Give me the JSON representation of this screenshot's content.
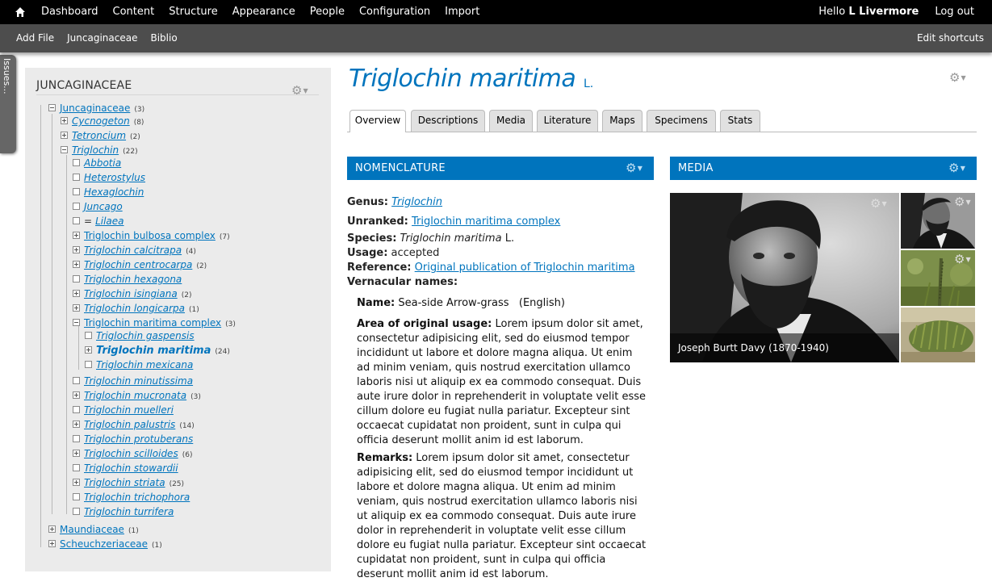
{
  "toolbar": {
    "menu": [
      "Dashboard",
      "Content",
      "Structure",
      "Appearance",
      "People",
      "Configuration",
      "Import"
    ],
    "hello_prefix": "Hello ",
    "user": "L Livermore",
    "logout": "Log out"
  },
  "shortcuts": {
    "items": [
      "Add File",
      "Juncaginaceae",
      "Biblio"
    ],
    "edit": "Edit shortcuts"
  },
  "issues_tab": "Issues...",
  "tree": {
    "title": "JUNCAGINACEAE",
    "nodes": [
      {
        "label": "Juncaginaceae",
        "count": "(3)"
      },
      {
        "label": "Cycnogeton",
        "count": "(8)"
      },
      {
        "label": "Tetroncium",
        "count": "(2)"
      },
      {
        "label": "Triglochin",
        "count": "(22)"
      },
      {
        "label": "Abbotia",
        "count": ""
      },
      {
        "label": "Heterostylus",
        "count": ""
      },
      {
        "label": "Hexaglochin",
        "count": ""
      },
      {
        "label": "Juncago",
        "count": ""
      },
      {
        "label": "Lilaea",
        "count": "",
        "prefix": "="
      },
      {
        "label": "Triglochin bulbosa complex",
        "count": "(7)"
      },
      {
        "label": "Triglochin calcitrapa",
        "count": "(4)"
      },
      {
        "label": "Triglochin centrocarpa",
        "count": "(2)"
      },
      {
        "label": "Triglochin hexagona",
        "count": ""
      },
      {
        "label": "Triglochin isingiana",
        "count": "(2)"
      },
      {
        "label": "Triglochin longicarpa",
        "count": "(1)"
      },
      {
        "label": "Triglochin maritima complex",
        "count": "(3)"
      },
      {
        "label": "Triglochin gaspensis",
        "count": ""
      },
      {
        "label": "Triglochin maritima",
        "count": "(24)"
      },
      {
        "label": "Triglochin mexicana",
        "count": ""
      },
      {
        "label": "Triglochin minutissima",
        "count": ""
      },
      {
        "label": "Triglochin mucronata",
        "count": "(3)"
      },
      {
        "label": "Triglochin muelleri",
        "count": ""
      },
      {
        "label": "Triglochin palustris",
        "count": "(14)"
      },
      {
        "label": "Triglochin protuberans",
        "count": ""
      },
      {
        "label": "Triglochin scilloides",
        "count": "(6)"
      },
      {
        "label": "Triglochin stowardii",
        "count": ""
      },
      {
        "label": "Triglochin striata",
        "count": "(25)"
      },
      {
        "label": "Triglochin trichophora",
        "count": ""
      },
      {
        "label": "Triglochin turrifera",
        "count": ""
      },
      {
        "label": "Maundiaceae",
        "count": "(1)"
      },
      {
        "label": "Scheuchzeriaceae",
        "count": "(1)"
      }
    ]
  },
  "taxon": {
    "name": "Triglochin maritima",
    "author": "L."
  },
  "tabs": [
    "Overview",
    "Descriptions",
    "Media",
    "Literature",
    "Maps",
    "Specimens",
    "Stats"
  ],
  "nomenclature": {
    "header": "NOMENCLATURE",
    "genus_label": "Genus:",
    "genus_value": "Triglochin",
    "unranked_label": "Unranked:",
    "unranked_value": "Triglochin maritima complex",
    "species_label": "Species:",
    "species_value": "Triglochin maritima",
    "species_author": "L.",
    "usage_label": "Usage:",
    "usage_value": "accepted",
    "reference_label": "Reference:",
    "reference_value": "Original publication of Triglochin maritima",
    "vernacular_label": "Vernacular names:",
    "vern_name_label": "Name:",
    "vern_name_value": "Sea-side Arrow-grass   (English)",
    "area_label": "Area of original usage:",
    "area_value": "Lorem ipsum dolor sit amet, consectetur adipisicing elit, sed do eiusmod tempor incididunt ut labore et dolore magna aliqua. Ut enim ad minim veniam, quis nostrud exercitation ullamco laboris nisi ut aliquip ex ea commodo consequat. Duis aute irure dolor in reprehenderit in voluptate velit esse cillum dolore eu fugiat nulla pariatur. Excepteur sint occaecat cupidatat non proident, sunt in culpa qui officia deserunt mollit anim id est laborum.",
    "remarks_label": "Remarks:",
    "remarks_value": "Lorem ipsum dolor sit amet, consectetur adipisicing elit, sed do eiusmod tempor incididunt ut labore et dolore magna aliqua. Ut enim ad minim veniam, quis nostrud exercitation ullamco laboris nisi ut aliquip ex ea commodo consequat. Duis aute irure dolor in reprehenderit in voluptate velit esse cillum dolore eu fugiat nulla pariatur. Excepteur sint occaecat cupidatat non proident, sunt in culpa qui officia deserunt mollit anim id est laborum."
  },
  "media": {
    "header": "MEDIA",
    "main_caption": "Joseph Burtt Davy (1870-1940)"
  },
  "colors": {
    "brand_blue": "#0074bd",
    "toolbar_black": "#000000",
    "shortcut_gray": "#4d4d4d"
  }
}
